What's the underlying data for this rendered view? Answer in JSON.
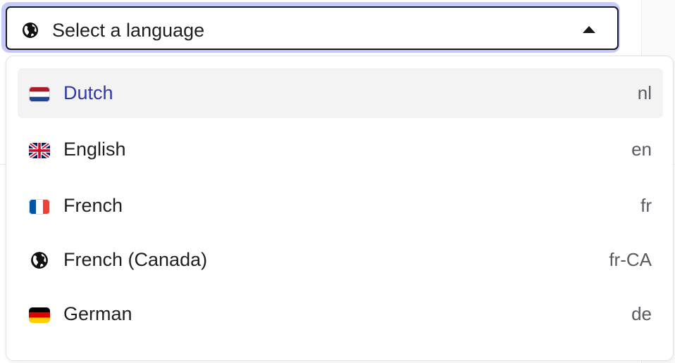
{
  "select": {
    "placeholder": "Select a language",
    "icon": "globe-icon",
    "state": "open"
  },
  "options": [
    {
      "label": "Dutch",
      "code": "nl",
      "icon": "flag-nl-icon",
      "highlighted": true
    },
    {
      "label": "English",
      "code": "en",
      "icon": "flag-gb-icon",
      "highlighted": false
    },
    {
      "label": "French",
      "code": "fr",
      "icon": "flag-fr-icon",
      "highlighted": false
    },
    {
      "label": "French (Canada)",
      "code": "fr-CA",
      "icon": "globe-icon",
      "highlighted": false
    },
    {
      "label": "German",
      "code": "de",
      "icon": "flag-de-icon",
      "highlighted": false
    }
  ],
  "colors": {
    "focus_ring": "#c7cbfb",
    "highlight_bg": "#f3f3f4",
    "highlight_text": "#3137a8"
  }
}
